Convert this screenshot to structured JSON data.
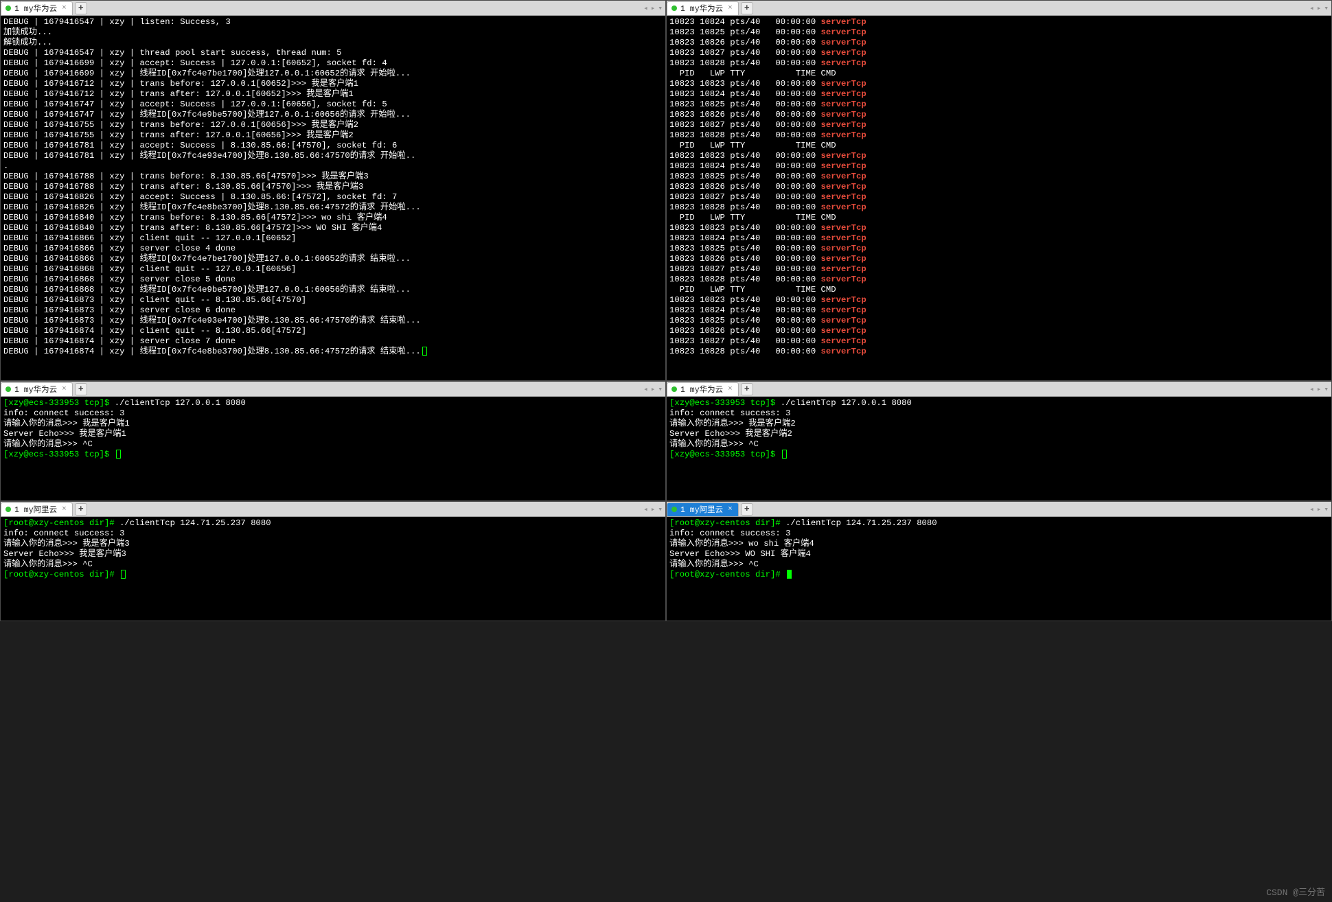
{
  "tabs": {
    "huawei": "1 my华为云",
    "aliyun": "1 my阿里云"
  },
  "colors": {
    "green": "#00ff00",
    "red": "#e74c3c",
    "bg": "#000000",
    "tab_active_blue": "#1e7fd6"
  },
  "topLeft": {
    "lines": [
      [
        [
          "w",
          "DEBUG | 1679416547 | xzy | listen: Success, 3"
        ]
      ],
      [
        [
          "w",
          "加锁成功..."
        ]
      ],
      [
        [
          "w",
          "解锁成功..."
        ]
      ],
      [
        [
          "w",
          "DEBUG | 1679416547 | xzy | thread pool start success, thread num: 5"
        ]
      ],
      [
        [
          "w",
          "DEBUG | 1679416699 | xzy | accept: Success | 127.0.0.1:[60652], socket fd: 4"
        ]
      ],
      [
        [
          "w",
          "DEBUG | 1679416699 | xzy | 线程ID[0x7fc4e7be1700]处理127.0.0.1:60652的请求 开始啦..."
        ]
      ],
      [
        [
          "w",
          "DEBUG | 1679416712 | xzy | trans before: 127.0.0.1[60652]>>> 我是客户端1"
        ]
      ],
      [
        [
          "w",
          "DEBUG | 1679416712 | xzy | trans after: 127.0.0.1[60652]>>> 我是客户端1"
        ]
      ],
      [
        [
          "w",
          "DEBUG | 1679416747 | xzy | accept: Success | 127.0.0.1:[60656], socket fd: 5"
        ]
      ],
      [
        [
          "w",
          "DEBUG | 1679416747 | xzy | 线程ID[0x7fc4e9be5700]处理127.0.0.1:60656的请求 开始啦..."
        ]
      ],
      [
        [
          "w",
          "DEBUG | 1679416755 | xzy | trans before: 127.0.0.1[60656]>>> 我是客户端2"
        ]
      ],
      [
        [
          "w",
          "DEBUG | 1679416755 | xzy | trans after: 127.0.0.1[60656]>>> 我是客户端2"
        ]
      ],
      [
        [
          "w",
          "DEBUG | 1679416781 | xzy | accept: Success | 8.130.85.66:[47570], socket fd: 6"
        ]
      ],
      [
        [
          "w",
          "DEBUG | 1679416781 | xzy | 线程ID[0x7fc4e93e4700]处理8.130.85.66:47570的请求 开始啦.."
        ]
      ],
      [
        [
          "w",
          "."
        ]
      ],
      [
        [
          "w",
          "DEBUG | 1679416788 | xzy | trans before: 8.130.85.66[47570]>>> 我是客户端3"
        ]
      ],
      [
        [
          "w",
          "DEBUG | 1679416788 | xzy | trans after: 8.130.85.66[47570]>>> 我是客户端3"
        ]
      ],
      [
        [
          "w",
          "DEBUG | 1679416826 | xzy | accept: Success | 8.130.85.66:[47572], socket fd: 7"
        ]
      ],
      [
        [
          "w",
          "DEBUG | 1679416826 | xzy | 线程ID[0x7fc4e8be3700]处理8.130.85.66:47572的请求 开始啦..."
        ]
      ],
      [
        [
          "w",
          "DEBUG | 1679416840 | xzy | trans before: 8.130.85.66[47572]>>> wo shi 客户端4"
        ]
      ],
      [
        [
          "w",
          "DEBUG | 1679416840 | xzy | trans after: 8.130.85.66[47572]>>> WO SHI 客户端4"
        ]
      ],
      [
        [
          "w",
          "DEBUG | 1679416866 | xzy | client quit -- 127.0.0.1[60652]"
        ]
      ],
      [
        [
          "w",
          "DEBUG | 1679416866 | xzy | server close 4 done"
        ]
      ],
      [
        [
          "w",
          "DEBUG | 1679416866 | xzy | 线程ID[0x7fc4e7be1700]处理127.0.0.1:60652的请求 结束啦..."
        ]
      ],
      [
        [
          "w",
          "DEBUG | 1679416868 | xzy | client quit -- 127.0.0.1[60656]"
        ]
      ],
      [
        [
          "w",
          "DEBUG | 1679416868 | xzy | server close 5 done"
        ]
      ],
      [
        [
          "w",
          "DEBUG | 1679416868 | xzy | 线程ID[0x7fc4e9be5700]处理127.0.0.1:60656的请求 结束啦..."
        ]
      ],
      [
        [
          "w",
          "DEBUG | 1679416873 | xzy | client quit -- 8.130.85.66[47570]"
        ]
      ],
      [
        [
          "w",
          "DEBUG | 1679416873 | xzy | server close 6 done"
        ]
      ],
      [
        [
          "w",
          "DEBUG | 1679416873 | xzy | 线程ID[0x7fc4e93e4700]处理8.130.85.66:47570的请求 结束啦..."
        ]
      ],
      [
        [
          "w",
          "DEBUG | 1679416874 | xzy | client quit -- 8.130.85.66[47572]"
        ]
      ],
      [
        [
          "w",
          "DEBUG | 1679416874 | xzy | server close 7 done"
        ]
      ],
      [
        [
          "w",
          "DEBUG | 1679416874 | xzy | 线程ID[0x7fc4e8be3700]处理8.130.85.66:47572的请求 结束啦..."
        ]
      ]
    ]
  },
  "topRight": {
    "headerRow": [
      [
        "w",
        "  PID   LWP TTY          TIME CMD"
      ]
    ],
    "rows": [
      [
        "10823",
        "10824",
        "pts/40",
        "00:00:00",
        "serverTcp"
      ],
      [
        "10823",
        "10825",
        "pts/40",
        "00:00:00",
        "serverTcp"
      ],
      [
        "10823",
        "10826",
        "pts/40",
        "00:00:00",
        "serverTcp"
      ],
      [
        "10823",
        "10827",
        "pts/40",
        "00:00:00",
        "serverTcp"
      ],
      [
        "10823",
        "10828",
        "pts/40",
        "00:00:00",
        "serverTcp"
      ]
    ],
    "fullSet": [
      [
        "10823",
        "10823",
        "pts/40",
        "00:00:00",
        "serverTcp"
      ],
      [
        "10823",
        "10824",
        "pts/40",
        "00:00:00",
        "serverTcp"
      ],
      [
        "10823",
        "10825",
        "pts/40",
        "00:00:00",
        "serverTcp"
      ],
      [
        "10823",
        "10826",
        "pts/40",
        "00:00:00",
        "serverTcp"
      ],
      [
        "10823",
        "10827",
        "pts/40",
        "00:00:00",
        "serverTcp"
      ],
      [
        "10823",
        "10828",
        "pts/40",
        "00:00:00",
        "serverTcp"
      ]
    ],
    "repeatedBlocks": 4
  },
  "midLeft": {
    "lines": [
      [
        [
          "g",
          "[xzy@ecs-333953 tcp]$ "
        ],
        [
          "w",
          "./clientTcp 127.0.0.1 8080"
        ]
      ],
      [
        [
          "w",
          "info: connect success: 3"
        ]
      ],
      [
        [
          "w",
          "请输入你的消息>>> 我是客户端1"
        ]
      ],
      [
        [
          "w",
          "Server Echo>>> 我是客户端1"
        ]
      ],
      [
        [
          "w",
          "请输入你的消息>>> ^C"
        ]
      ],
      [
        [
          "g",
          "[xzy@ecs-333953 tcp]$ "
        ]
      ]
    ]
  },
  "midRight": {
    "lines": [
      [
        [
          "g",
          "[xzy@ecs-333953 tcp]$ "
        ],
        [
          "w",
          "./clientTcp 127.0.0.1 8080"
        ]
      ],
      [
        [
          "w",
          "info: connect success: 3"
        ]
      ],
      [
        [
          "w",
          "请输入你的消息>>> 我是客户端2"
        ]
      ],
      [
        [
          "w",
          "Server Echo>>> 我是客户端2"
        ]
      ],
      [
        [
          "w",
          "请输入你的消息>>> ^C"
        ]
      ],
      [
        [
          "g",
          "[xzy@ecs-333953 tcp]$ "
        ]
      ]
    ]
  },
  "botLeft": {
    "lines": [
      [
        [
          "g",
          "[root@xzy-centos dir]# "
        ],
        [
          "w",
          "./clientTcp 124.71.25.237 8080"
        ]
      ],
      [
        [
          "w",
          "info: connect success: 3"
        ]
      ],
      [
        [
          "w",
          "请输入你的消息>>> 我是客户端3"
        ]
      ],
      [
        [
          "w",
          "Server Echo>>> 我是客户端3"
        ]
      ],
      [
        [
          "w",
          "请输入你的消息>>> ^C"
        ]
      ],
      [
        [
          "g",
          "[root@xzy-centos dir]# "
        ]
      ]
    ]
  },
  "botRight": {
    "lines": [
      [
        [
          "g",
          "[root@xzy-centos dir]# "
        ],
        [
          "w",
          "./clientTcp 124.71.25.237 8080"
        ]
      ],
      [
        [
          "w",
          "info: connect success: 3"
        ]
      ],
      [
        [
          "w",
          "请输入你的消息>>> wo shi 客户端4"
        ]
      ],
      [
        [
          "w",
          "Server Echo>>> WO SHI 客户端4"
        ]
      ],
      [
        [
          "w",
          "请输入你的消息>>> ^C"
        ]
      ],
      [
        [
          "g",
          "[root@xzy-centos dir]# "
        ]
      ]
    ]
  },
  "watermark": "CSDN @三分苦"
}
